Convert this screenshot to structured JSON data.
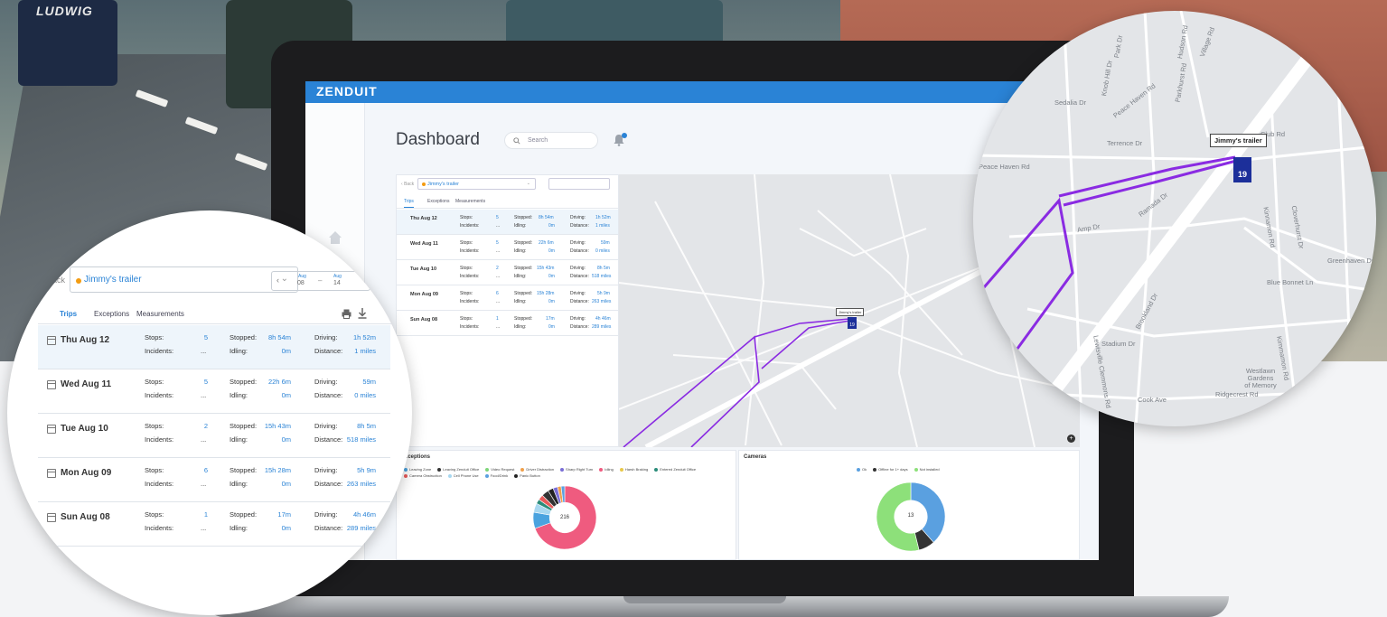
{
  "app": {
    "logo": "ZENDUIT"
  },
  "dashboard": {
    "title": "Dashboard",
    "search_placeholder": "Search"
  },
  "trips_panel": {
    "back_label": "Back",
    "vehicle_name": "Jimmy's trailer",
    "date_from_month": "Aug",
    "date_from_day": "08",
    "date_to_month": "Aug",
    "date_to_day": "14",
    "tabs": [
      "Trips",
      "Exceptions",
      "Measurements"
    ],
    "labels": {
      "stops": "Stops:",
      "incidents": "Incidents:",
      "stopped": "Stopped:",
      "idling": "Idling:",
      "driving": "Driving:",
      "distance": "Distance:"
    },
    "rows": [
      {
        "day": "Thu Aug 12",
        "stops": "5",
        "incidents": "...",
        "stopped": "8h 54m",
        "idling": "0m",
        "driving": "1h 52m",
        "distance": "1 miles"
      },
      {
        "day": "Wed Aug 11",
        "stops": "5",
        "incidents": "...",
        "stopped": "22h 6m",
        "idling": "0m",
        "driving": "59m",
        "distance": "0 miles"
      },
      {
        "day": "Tue Aug 10",
        "stops": "2",
        "incidents": "...",
        "stopped": "15h 43m",
        "idling": "0m",
        "driving": "8h 5m",
        "distance": "518 miles"
      },
      {
        "day": "Mon Aug 09",
        "stops": "6",
        "incidents": "...",
        "stopped": "15h 28m",
        "idling": "0m",
        "driving": "5h 9m",
        "distance": "263 miles"
      },
      {
        "day": "Sun Aug 08",
        "stops": "1",
        "incidents": "...",
        "stopped": "17m",
        "idling": "0m",
        "driving": "4h 46m",
        "distance": "289 miles"
      }
    ]
  },
  "map": {
    "tooltip": "Jimmy's trailer",
    "marker_number": "19",
    "zoom_plus": "+",
    "street_labels": [
      "Sedalia Dr",
      "Peace Haven Rd",
      "Terrence Dr",
      "Club Rd",
      "Peace Haven Rd",
      "Amp Dr",
      "Ramada Dr",
      "Brookland Dr",
      "Kinnamon Rd",
      "Cloverhurst Dr",
      "Greenhaven Dr",
      "Blue Bonnet Ln",
      "Stadium Dr",
      "Lewisville Clemmons Rd",
      "Westlawn Gardens of Memory",
      "Ridgecrest Rd",
      "Cook Ave",
      "Kimmamon Rd",
      "Knob Hill Dr",
      "Parkhurst Rd",
      "Hudson Rd",
      "Park Dr",
      "Village Rd"
    ]
  },
  "exceptions_card": {
    "title": "Exceptions",
    "total": "216",
    "legend": [
      {
        "label": "Leaving Zone",
        "color": "#4aa3df"
      },
      {
        "label": "Leaving Zenduit Office",
        "color": "#333333"
      },
      {
        "label": "Video Request",
        "color": "#7ed67a"
      },
      {
        "label": "Driver Distraction",
        "color": "#f0a04b"
      },
      {
        "label": "Sharp Right Turn",
        "color": "#7a6ed6"
      },
      {
        "label": "Idling",
        "color": "#ef5b7f"
      },
      {
        "label": "Harsh Braking",
        "color": "#e8c84a"
      },
      {
        "label": "Entered Zenduit Office",
        "color": "#2a8c7a"
      },
      {
        "label": "Camera Obstruction",
        "color": "#e85a5a"
      },
      {
        "label": "Cell Phone Use",
        "color": "#a8d8f0"
      },
      {
        "label": "Food/Drink",
        "color": "#5aa0e0"
      },
      {
        "label": "Panic Button",
        "color": "#222222"
      }
    ],
    "slices": [
      {
        "name": "Idling",
        "value": 150,
        "color": "#ef5b7f"
      },
      {
        "name": "Leaving Zone",
        "value": 18,
        "color": "#4aa3df"
      },
      {
        "name": "Cell Phone Use",
        "value": 10,
        "color": "#a8d8f0"
      },
      {
        "name": "Entered Zenduit Office",
        "value": 5,
        "color": "#2a8c7a"
      },
      {
        "name": "Camera Obstruction",
        "value": 6,
        "color": "#e85a5a"
      },
      {
        "name": "Leaving Zenduit Office",
        "value": 8,
        "color": "#333333"
      },
      {
        "name": "Panic Button",
        "value": 6,
        "color": "#222222"
      },
      {
        "name": "Sharp Right Turn",
        "value": 5,
        "color": "#7a6ed6"
      },
      {
        "name": "Driver Distraction",
        "value": 4,
        "color": "#f0a04b"
      },
      {
        "name": "Food/Drink",
        "value": 4,
        "color": "#5aa0e0"
      }
    ]
  },
  "cameras_card": {
    "title": "Cameras",
    "total": "13",
    "legend": [
      {
        "label": "Ok",
        "color": "#5aa0e0"
      },
      {
        "label": "Offline for 1+ days",
        "color": "#333333"
      },
      {
        "label": "Not installed",
        "color": "#8de07a"
      }
    ],
    "slices": [
      {
        "name": "Ok",
        "value": 5,
        "color": "#5aa0e0"
      },
      {
        "name": "Offline for 1+ days",
        "value": 1,
        "color": "#333333"
      },
      {
        "name": "Not installed",
        "value": 7,
        "color": "#8de07a"
      }
    ]
  },
  "background": {
    "truck_label": "LUDWIG"
  }
}
